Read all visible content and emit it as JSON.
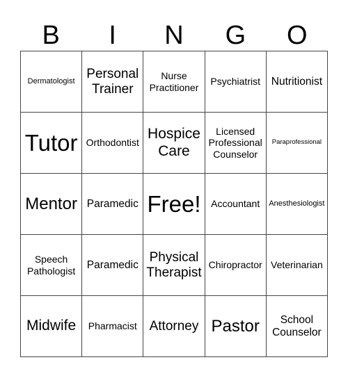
{
  "header": [
    "B",
    "I",
    "N",
    "G",
    "O"
  ],
  "cells": [
    {
      "text": "Dermatologist",
      "size": "s10"
    },
    {
      "text": "Personal Trainer",
      "size": "s18"
    },
    {
      "text": "Nurse Practitioner",
      "size": "s13"
    },
    {
      "text": "Psychiatrist",
      "size": "s13"
    },
    {
      "text": "Nutritionist",
      "size": "s15"
    },
    {
      "text": "Tutor",
      "size": "s33"
    },
    {
      "text": "Orthodontist",
      "size": "s13"
    },
    {
      "text": "Hospice Care",
      "size": "s21"
    },
    {
      "text": "Licensed Professional Counselor",
      "size": "s13"
    },
    {
      "text": "Paraprofessional",
      "size": "s9"
    },
    {
      "text": "Mentor",
      "size": "s24"
    },
    {
      "text": "Paramedic",
      "size": "s15"
    },
    {
      "text": "Free!",
      "size": "s33"
    },
    {
      "text": "Accountant",
      "size": "s13"
    },
    {
      "text": "Anesthesiologist",
      "size": "s10"
    },
    {
      "text": "Speech Pathologist",
      "size": "s13"
    },
    {
      "text": "Paramedic",
      "size": "s15"
    },
    {
      "text": "Physical Therapist",
      "size": "s18"
    },
    {
      "text": "Chiropractor",
      "size": "s13"
    },
    {
      "text": "Veterinarian",
      "size": "s13"
    },
    {
      "text": "Midwife",
      "size": "s21"
    },
    {
      "text": "Pharmacist",
      "size": "s13"
    },
    {
      "text": "Attorney",
      "size": "s18"
    },
    {
      "text": "Pastor",
      "size": "s24"
    },
    {
      "text": "School Counselor",
      "size": "s15"
    }
  ]
}
